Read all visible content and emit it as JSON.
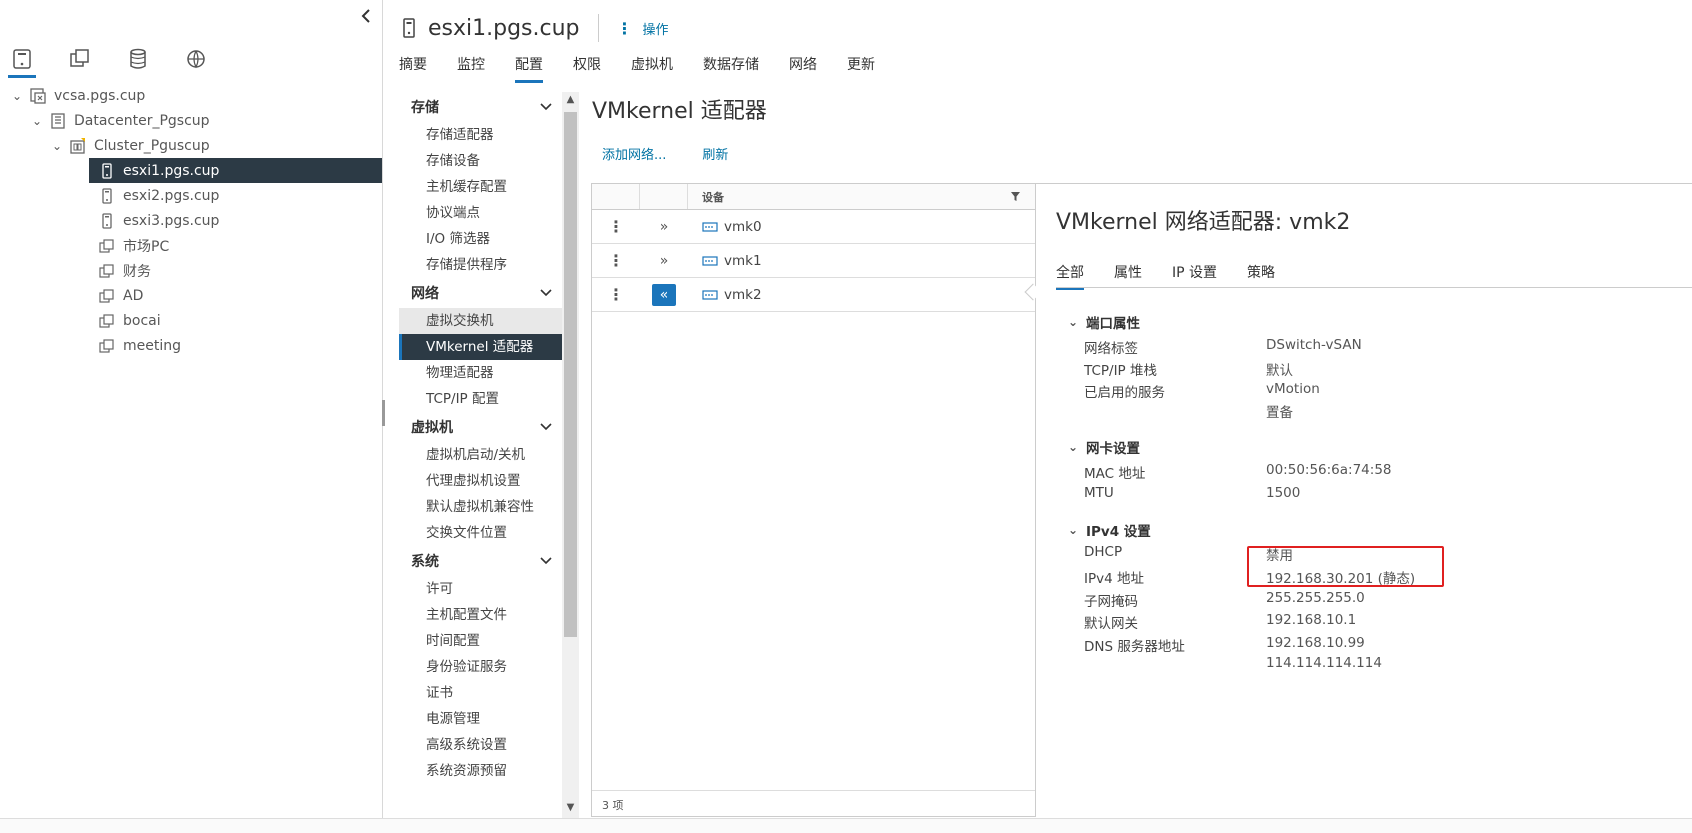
{
  "navigator": {
    "collapse_icon": "chevron-left-icon",
    "nav_icons": [
      "hosts-clusters-icon",
      "vms-templates-icon",
      "storage-icon",
      "networking-icon"
    ],
    "tree": [
      {
        "label": "vcsa.pgs.cup",
        "icon": "vcenter-icon",
        "level": 0,
        "expanded": true
      },
      {
        "label": "Datacenter_Pgscup",
        "icon": "datacenter-icon",
        "level": 1,
        "expanded": true
      },
      {
        "label": "Cluster_Pguscup",
        "icon": "cluster-icon",
        "level": 2,
        "expanded": true
      },
      {
        "label": "esxi1.pgs.cup",
        "icon": "host-icon",
        "level": 3,
        "selected": true
      },
      {
        "label": "esxi2.pgs.cup",
        "icon": "host-icon",
        "level": 3
      },
      {
        "label": "esxi3.pgs.cup",
        "icon": "host-icon",
        "level": 3
      },
      {
        "label": "市场PC",
        "icon": "vapp-icon",
        "level": 3
      },
      {
        "label": "财务",
        "icon": "vapp-icon",
        "level": 3
      },
      {
        "label": "AD",
        "icon": "vapp-icon",
        "level": 3
      },
      {
        "label": "bocai",
        "icon": "vapp-icon",
        "level": 3
      },
      {
        "label": "meeting",
        "icon": "vapp-icon",
        "level": 3
      }
    ]
  },
  "header": {
    "title": "esxi1.pgs.cup",
    "actions_label": "操作",
    "tabs": [
      "摘要",
      "监控",
      "配置",
      "权限",
      "虚拟机",
      "数据存储",
      "网络",
      "更新"
    ],
    "active_tab": "配置"
  },
  "config_nav": {
    "groups": [
      {
        "label": "存储",
        "items": [
          "存储适配器",
          "存储设备",
          "主机缓存配置",
          "协议端点",
          "I/O 筛选器",
          "存储提供程序"
        ]
      },
      {
        "label": "网络",
        "items": [
          "虚拟交换机",
          "VMkernel 适配器",
          "物理适配器",
          "TCP/IP 配置"
        ]
      },
      {
        "label": "虚拟机",
        "items": [
          "虚拟机启动/关机",
          "代理虚拟机设置",
          "默认虚拟机兼容性",
          "交换文件位置"
        ]
      },
      {
        "label": "系统",
        "items": [
          "许可",
          "主机配置文件",
          "时间配置",
          "身份验证服务",
          "证书",
          "电源管理",
          "高级系统设置",
          "系统资源预留"
        ]
      }
    ],
    "selected_item": "VMkernel 适配器",
    "hover_item": "虚拟交换机"
  },
  "content": {
    "title": "VMkernel 适配器",
    "add_network_label": "添加网络...",
    "refresh_label": "刷新"
  },
  "grid": {
    "column_device": "设备",
    "rows": [
      {
        "device": "vmk0",
        "selected": false
      },
      {
        "device": "vmk1",
        "selected": false
      },
      {
        "device": "vmk2",
        "selected": true
      }
    ],
    "footer": "3 项"
  },
  "detail": {
    "title": "VMkernel 网络适配器: vmk2",
    "tabs": [
      "全部",
      "属性",
      "IP 设置",
      "策略"
    ],
    "active_tab": "全部",
    "sections": {
      "port": {
        "label": "端口属性",
        "network_label_key": "网络标签",
        "network_label_val": "DSwitch-vSAN",
        "tcpip_key": "TCP/IP 堆栈",
        "tcpip_val": "默认",
        "services_key": "已启用的服务",
        "services_val1": "vMotion",
        "services_val2": "置备"
      },
      "nic": {
        "label": "网卡设置",
        "mac_key": "MAC 地址",
        "mac_val": "00:50:56:6a:74:58",
        "mtu_key": "MTU",
        "mtu_val": "1500"
      },
      "ipv4": {
        "label": "IPv4 设置",
        "dhcp_key": "DHCP",
        "dhcp_val": "禁用",
        "addr_key": "IPv4 地址",
        "addr_val": "192.168.30.201 (静态)",
        "mask_key": "子网掩码",
        "mask_val": "255.255.255.0",
        "gw_key": "默认网关",
        "gw_val": "192.168.10.1",
        "dns_key": "DNS 服务器地址",
        "dns_val1": "192.168.10.99",
        "dns_val2": "114.114.114.114"
      }
    }
  },
  "colors": {
    "accent": "#1b75bb",
    "link": "#0072a3",
    "selected_bg": "#2c3a45",
    "highlight": "#e02020"
  }
}
